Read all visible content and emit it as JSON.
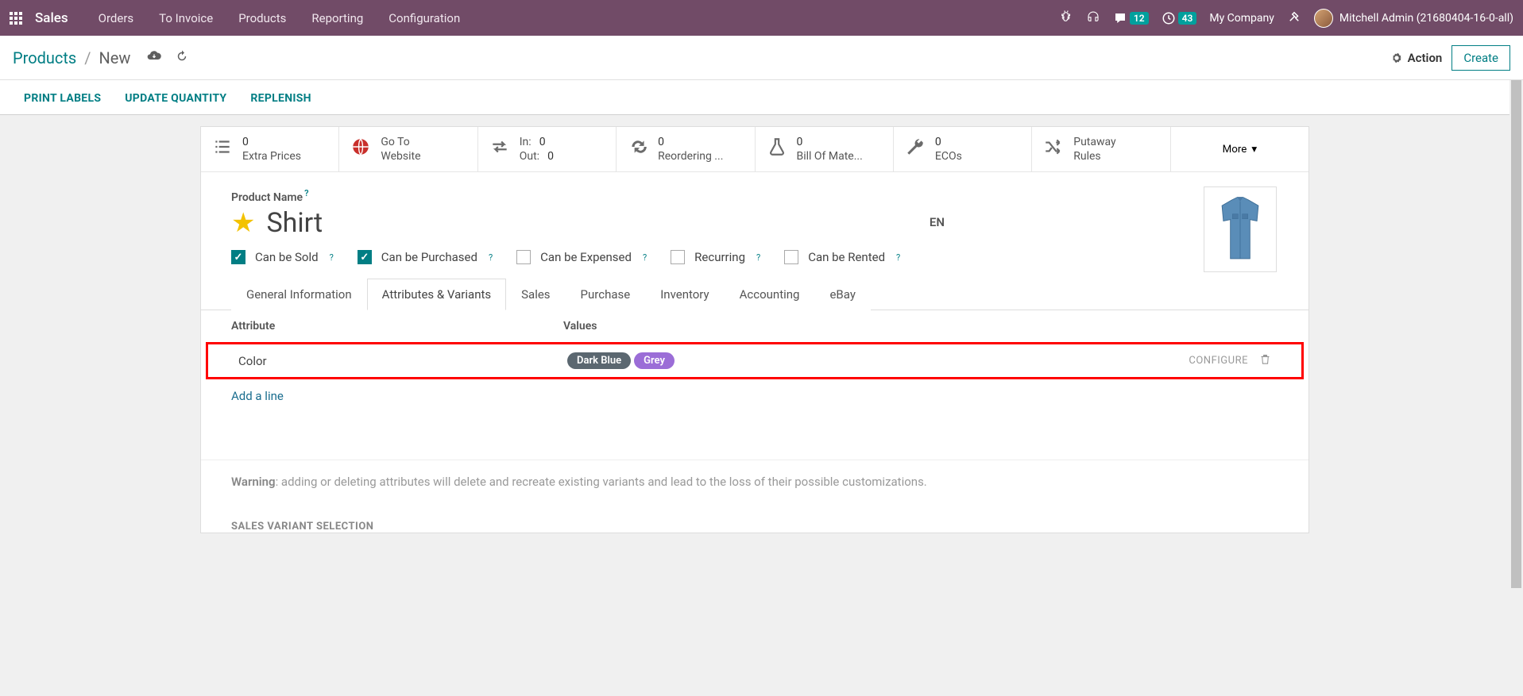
{
  "topbar": {
    "brand": "Sales",
    "nav": [
      "Orders",
      "To Invoice",
      "Products",
      "Reporting",
      "Configuration"
    ],
    "messages_badge": "12",
    "activities_badge": "43",
    "company": "My Company",
    "user": "Mitchell Admin (21680404-16-0-all)"
  },
  "header": {
    "breadcrumb_root": "Products",
    "breadcrumb_current": "New",
    "action_label": "Action",
    "create_label": "Create"
  },
  "actions": {
    "print_labels": "PRINT LABELS",
    "update_qty": "UPDATE QUANTITY",
    "replenish": "REPLENISH"
  },
  "stats": {
    "extra_prices_count": "0",
    "extra_prices_label": "Extra Prices",
    "website_line1": "Go To",
    "website_line2": "Website",
    "in_label": "In:",
    "in_count": "0",
    "out_label": "Out:",
    "out_count": "0",
    "reorder_count": "0",
    "reorder_label": "Reordering ...",
    "bom_count": "0",
    "bom_label": "Bill Of Mate...",
    "eco_count": "0",
    "eco_label": "ECOs",
    "putaway_line1": "Putaway",
    "putaway_line2": "Rules",
    "more_label": "More"
  },
  "product": {
    "name_label": "Product Name",
    "name": "Shirt",
    "lang": "EN",
    "can_be_sold": "Can be Sold",
    "can_be_purchased": "Can be Purchased",
    "can_be_expensed": "Can be Expensed",
    "recurring": "Recurring",
    "can_be_rented": "Can be Rented"
  },
  "tabs": [
    "General Information",
    "Attributes & Variants",
    "Sales",
    "Purchase",
    "Inventory",
    "Accounting",
    "eBay"
  ],
  "attributes": {
    "col_attribute": "Attribute",
    "col_values": "Values",
    "row_attr": "Color",
    "val_darkblue": "Dark Blue",
    "val_grey": "Grey",
    "configure": "CONFIGURE",
    "add_line": "Add a line"
  },
  "warning": {
    "prefix": "Warning",
    "text": ": adding or deleting attributes will delete and recreate existing variants and lead to the loss of their possible customizations."
  },
  "section": {
    "variant_selection": "SALES VARIANT SELECTION"
  }
}
